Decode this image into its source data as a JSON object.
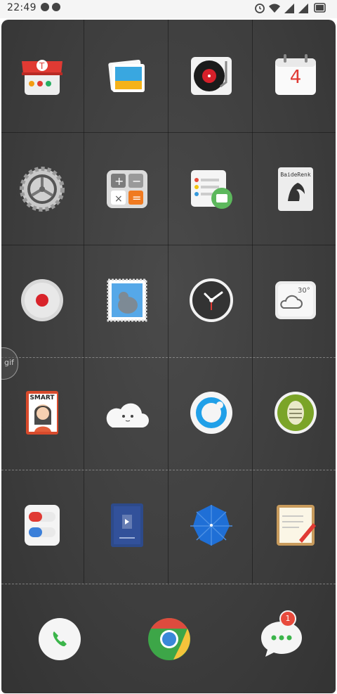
{
  "status_bar": {
    "time": "22:49",
    "icons": [
      "notification-1-icon",
      "notification-2-icon",
      "alarm-icon",
      "wifi-icon",
      "signal-icon",
      "signal-icon",
      "battery-icon"
    ]
  },
  "home": {
    "apps": [
      {
        "name": "store-app",
        "icon": "shop-icon"
      },
      {
        "name": "gallery-app",
        "icon": "photo-icon"
      },
      {
        "name": "music-app",
        "icon": "record-player-icon"
      },
      {
        "name": "calendar-app",
        "icon": "calendar-icon",
        "label": "4"
      },
      {
        "name": "settings-app",
        "icon": "gear-icon"
      },
      {
        "name": "calculator-app",
        "icon": "calculator-icon"
      },
      {
        "name": "file-manager-app",
        "icon": "folder-icon"
      },
      {
        "name": "baidu-reader-app",
        "icon": "lion-book-icon",
        "label": "BaideRenk"
      },
      {
        "name": "recorder-app",
        "icon": "record-icon"
      },
      {
        "name": "mail-app",
        "icon": "pigeon-stamp-icon"
      },
      {
        "name": "clock-app",
        "icon": "clock-icon"
      },
      {
        "name": "weather-app",
        "icon": "cloud-icon",
        "label": "30°"
      },
      {
        "name": "smart-id-app",
        "icon": "id-card-icon",
        "label": "SMART"
      },
      {
        "name": "cloud-app",
        "icon": "smiling-cloud-icon"
      },
      {
        "name": "browser-app",
        "icon": "ring-icon"
      },
      {
        "name": "security-app",
        "icon": "shield-icon"
      },
      {
        "name": "medicine-app",
        "icon": "pills-icon"
      },
      {
        "name": "video-app",
        "icon": "video-book-icon"
      },
      {
        "name": "umbrella-app",
        "icon": "umbrella-icon"
      },
      {
        "name": "notes-app",
        "icon": "notepad-icon"
      }
    ]
  },
  "dock": {
    "items": [
      {
        "name": "phone",
        "icon": "phone-icon"
      },
      {
        "name": "chrome",
        "icon": "chrome-icon"
      },
      {
        "name": "messages",
        "icon": "message-bubble-icon",
        "badge": "1"
      }
    ]
  },
  "side_handle": {
    "label": "gif"
  },
  "colors": {
    "accent_red": "#e84a3c",
    "wallpaper": "#3f3f3f"
  }
}
